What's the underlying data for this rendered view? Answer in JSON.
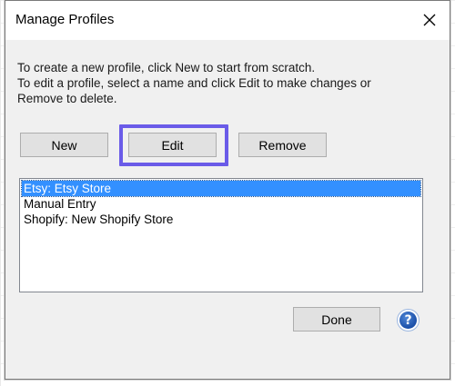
{
  "dialog": {
    "title": "Manage Profiles",
    "close_glyph": "✕",
    "description_lines": [
      "To create a new profile, click New to start from scratch.",
      "To edit a profile, select a name and click Edit to make changes or",
      "Remove to delete."
    ]
  },
  "actions": {
    "new_label": "New",
    "edit_label": "Edit",
    "remove_label": "Remove",
    "done_label": "Done",
    "help_glyph": "?"
  },
  "profiles": {
    "items": [
      {
        "label": "Etsy: Etsy Store",
        "selected": true
      },
      {
        "label": "Manual Entry",
        "selected": false
      },
      {
        "label": "Shopify: New Shopify Store",
        "selected": false
      }
    ]
  },
  "colors": {
    "highlight": "#6a5be8",
    "selection": "#3390ff",
    "dialog_bg": "#f0f0f0"
  },
  "icons": {
    "close": "close-icon",
    "help": "help-icon"
  }
}
